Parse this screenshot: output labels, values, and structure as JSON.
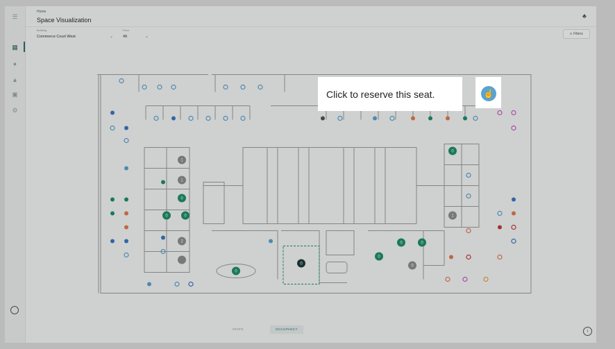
{
  "header": {
    "breadcrumb": "Home",
    "title": "Space Visualization",
    "building_label": "Building",
    "building_value": "Commerce Court West",
    "floor_label": "Floor",
    "floor_value": "49",
    "filters_label": "Filters"
  },
  "tooltip": {
    "text": "Click to reserve this seat."
  },
  "tabs": {
    "stats": "STATS",
    "occupancy": "OCCUPANCY"
  },
  "rooms": {
    "r1": "1",
    "r2": "1",
    "r3": "0",
    "r4": "0",
    "r5": "0",
    "r6": "2",
    "r7": "0",
    "r8": "0",
    "r9": "0",
    "r10": "0",
    "r11": "0",
    "r12": "0",
    "r13": "0",
    "r14": "0",
    "r15": "0",
    "r16": "1"
  },
  "colors": {
    "accent": "#2f6f6a",
    "available": "#5aa3cf",
    "occupied": "#e07b4f",
    "room": "#1e8f6b"
  }
}
